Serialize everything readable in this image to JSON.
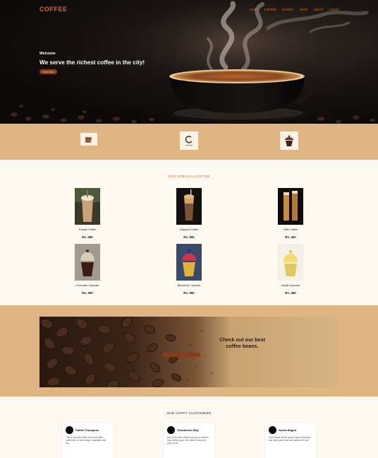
{
  "header": {
    "brand": "COFFEE",
    "nav": [
      "HOME",
      "COFFEE",
      "BAKERY",
      "SHOP",
      "ABOUT",
      "LOGIN"
    ]
  },
  "hero": {
    "welcome": "Welcome",
    "headline": "We serve the richest coffee in the city!",
    "button_label": "Order Now"
  },
  "icons": [
    "coffee-cup-icon",
    "coffee-logo-icon",
    "cupcake-icon"
  ],
  "special": {
    "title": "OUR SPECIAL COFFEE",
    "products": [
      {
        "name": "Frappe Coffee",
        "price": "Rs. 350",
        "image": "frappe-coffee-image"
      },
      {
        "name": "Dalgona Coffee",
        "price": "Rs. 500",
        "image": "dalgona-coffee-image"
      },
      {
        "name": "Filter Coffee",
        "price": "Rs. 400",
        "image": "filter-coffee-image"
      },
      {
        "name": "Chocolate Cupcake",
        "price": "Rs. 300",
        "image": "chocolate-cupcake-image"
      },
      {
        "name": "Blueberry Cupcake",
        "price": "Rs. 550",
        "image": "blueberry-cupcake-image"
      },
      {
        "name": "Vanilla Cupcake",
        "price": "Rs. 350",
        "image": "vanilla-cupcake-image"
      }
    ]
  },
  "banner": {
    "line1": "Check out our best",
    "line2": "coffee beans."
  },
  "customers": {
    "title": "OUR HAPPY CUSTOMERS",
    "reviews": [
      {
        "name": "Dalika Thompson",
        "text": "This is the best coffee shop that offers coffee like no other stage, available near my"
      },
      {
        "name": "Oluwatosin Moji",
        "text": "One of the nice cafes to hang out with the food before good, the coffee is also the price is not"
      },
      {
        "name": "Sweta Rajput",
        "text": "Good place where people spend free time and have good food and various hot and"
      }
    ]
  },
  "colors": {
    "accent": "#e06a1e",
    "band": "#dfb583",
    "cream": "#fdf9f0",
    "button": "#8a3c20"
  }
}
